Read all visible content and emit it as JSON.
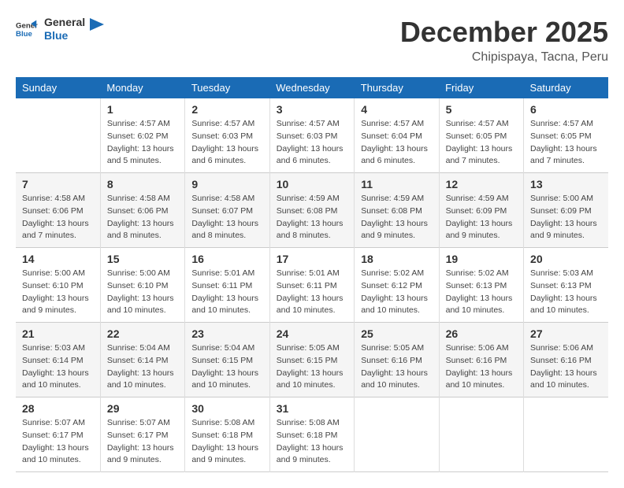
{
  "logo": {
    "text_general": "General",
    "text_blue": "Blue"
  },
  "title": "December 2025",
  "subtitle": "Chipispaya, Tacna, Peru",
  "days_of_week": [
    "Sunday",
    "Monday",
    "Tuesday",
    "Wednesday",
    "Thursday",
    "Friday",
    "Saturday"
  ],
  "weeks": [
    [
      {
        "day": "",
        "info": ""
      },
      {
        "day": "1",
        "info": "Sunrise: 4:57 AM\nSunset: 6:02 PM\nDaylight: 13 hours\nand 5 minutes."
      },
      {
        "day": "2",
        "info": "Sunrise: 4:57 AM\nSunset: 6:03 PM\nDaylight: 13 hours\nand 6 minutes."
      },
      {
        "day": "3",
        "info": "Sunrise: 4:57 AM\nSunset: 6:03 PM\nDaylight: 13 hours\nand 6 minutes."
      },
      {
        "day": "4",
        "info": "Sunrise: 4:57 AM\nSunset: 6:04 PM\nDaylight: 13 hours\nand 6 minutes."
      },
      {
        "day": "5",
        "info": "Sunrise: 4:57 AM\nSunset: 6:05 PM\nDaylight: 13 hours\nand 7 minutes."
      },
      {
        "day": "6",
        "info": "Sunrise: 4:57 AM\nSunset: 6:05 PM\nDaylight: 13 hours\nand 7 minutes."
      }
    ],
    [
      {
        "day": "7",
        "info": "Sunrise: 4:58 AM\nSunset: 6:06 PM\nDaylight: 13 hours\nand 7 minutes."
      },
      {
        "day": "8",
        "info": "Sunrise: 4:58 AM\nSunset: 6:06 PM\nDaylight: 13 hours\nand 8 minutes."
      },
      {
        "day": "9",
        "info": "Sunrise: 4:58 AM\nSunset: 6:07 PM\nDaylight: 13 hours\nand 8 minutes."
      },
      {
        "day": "10",
        "info": "Sunrise: 4:59 AM\nSunset: 6:08 PM\nDaylight: 13 hours\nand 8 minutes."
      },
      {
        "day": "11",
        "info": "Sunrise: 4:59 AM\nSunset: 6:08 PM\nDaylight: 13 hours\nand 9 minutes."
      },
      {
        "day": "12",
        "info": "Sunrise: 4:59 AM\nSunset: 6:09 PM\nDaylight: 13 hours\nand 9 minutes."
      },
      {
        "day": "13",
        "info": "Sunrise: 5:00 AM\nSunset: 6:09 PM\nDaylight: 13 hours\nand 9 minutes."
      }
    ],
    [
      {
        "day": "14",
        "info": "Sunrise: 5:00 AM\nSunset: 6:10 PM\nDaylight: 13 hours\nand 9 minutes."
      },
      {
        "day": "15",
        "info": "Sunrise: 5:00 AM\nSunset: 6:10 PM\nDaylight: 13 hours\nand 10 minutes."
      },
      {
        "day": "16",
        "info": "Sunrise: 5:01 AM\nSunset: 6:11 PM\nDaylight: 13 hours\nand 10 minutes."
      },
      {
        "day": "17",
        "info": "Sunrise: 5:01 AM\nSunset: 6:11 PM\nDaylight: 13 hours\nand 10 minutes."
      },
      {
        "day": "18",
        "info": "Sunrise: 5:02 AM\nSunset: 6:12 PM\nDaylight: 13 hours\nand 10 minutes."
      },
      {
        "day": "19",
        "info": "Sunrise: 5:02 AM\nSunset: 6:13 PM\nDaylight: 13 hours\nand 10 minutes."
      },
      {
        "day": "20",
        "info": "Sunrise: 5:03 AM\nSunset: 6:13 PM\nDaylight: 13 hours\nand 10 minutes."
      }
    ],
    [
      {
        "day": "21",
        "info": "Sunrise: 5:03 AM\nSunset: 6:14 PM\nDaylight: 13 hours\nand 10 minutes."
      },
      {
        "day": "22",
        "info": "Sunrise: 5:04 AM\nSunset: 6:14 PM\nDaylight: 13 hours\nand 10 minutes."
      },
      {
        "day": "23",
        "info": "Sunrise: 5:04 AM\nSunset: 6:15 PM\nDaylight: 13 hours\nand 10 minutes."
      },
      {
        "day": "24",
        "info": "Sunrise: 5:05 AM\nSunset: 6:15 PM\nDaylight: 13 hours\nand 10 minutes."
      },
      {
        "day": "25",
        "info": "Sunrise: 5:05 AM\nSunset: 6:16 PM\nDaylight: 13 hours\nand 10 minutes."
      },
      {
        "day": "26",
        "info": "Sunrise: 5:06 AM\nSunset: 6:16 PM\nDaylight: 13 hours\nand 10 minutes."
      },
      {
        "day": "27",
        "info": "Sunrise: 5:06 AM\nSunset: 6:16 PM\nDaylight: 13 hours\nand 10 minutes."
      }
    ],
    [
      {
        "day": "28",
        "info": "Sunrise: 5:07 AM\nSunset: 6:17 PM\nDaylight: 13 hours\nand 10 minutes."
      },
      {
        "day": "29",
        "info": "Sunrise: 5:07 AM\nSunset: 6:17 PM\nDaylight: 13 hours\nand 9 minutes."
      },
      {
        "day": "30",
        "info": "Sunrise: 5:08 AM\nSunset: 6:18 PM\nDaylight: 13 hours\nand 9 minutes."
      },
      {
        "day": "31",
        "info": "Sunrise: 5:08 AM\nSunset: 6:18 PM\nDaylight: 13 hours\nand 9 minutes."
      },
      {
        "day": "",
        "info": ""
      },
      {
        "day": "",
        "info": ""
      },
      {
        "day": "",
        "info": ""
      }
    ]
  ]
}
